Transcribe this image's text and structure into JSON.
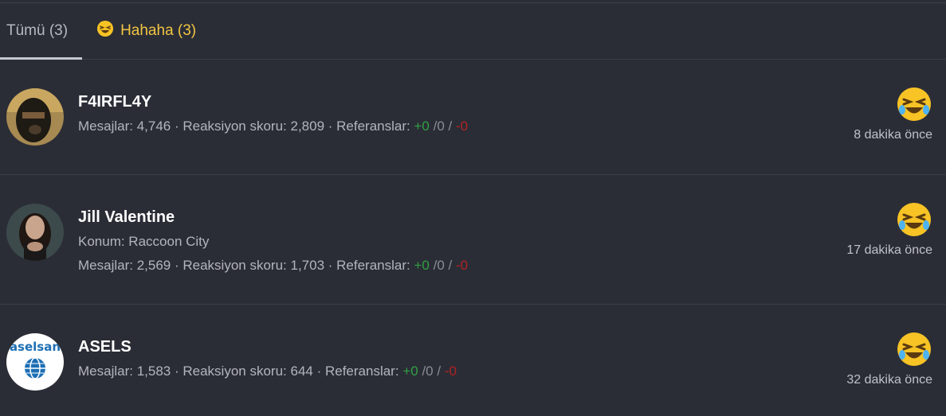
{
  "tabs": [
    {
      "label": "Tümü (3)"
    },
    {
      "label": "Hahaha (3)"
    }
  ],
  "users": [
    {
      "name": "F4IRFL4Y",
      "location": "",
      "messages_label": "Mesajlar:",
      "messages": "4,746",
      "reaction_label": "Reaksiyon skoru:",
      "reaction": "2,809",
      "ref_label": "Referanslar:",
      "ref_pos": "+0",
      "ref_neu": "0",
      "ref_neg": "-0",
      "time": "8 dakika önce"
    },
    {
      "name": "Jill Valentine",
      "location": "Konum: Raccoon City",
      "messages_label": "Mesajlar:",
      "messages": "2,569",
      "reaction_label": "Reaksiyon skoru:",
      "reaction": "1,703",
      "ref_label": "Referanslar:",
      "ref_pos": "+0",
      "ref_neu": "0",
      "ref_neg": "-0",
      "time": "17 dakika önce"
    },
    {
      "name": "ASELS",
      "location": "",
      "messages_label": "Mesajlar:",
      "messages": "1,583",
      "reaction_label": "Reaksiyon skoru:",
      "reaction": "644",
      "ref_label": "Referanslar:",
      "ref_pos": "+0",
      "ref_neu": "0",
      "ref_neg": "-0",
      "time": "32 dakika önce",
      "avatar_logo_text": "aselsan"
    }
  ],
  "colors": {
    "background": "#2b2d36",
    "accent_tab": "#f0c542",
    "positive": "#2ea043",
    "negative": "#b22222"
  }
}
